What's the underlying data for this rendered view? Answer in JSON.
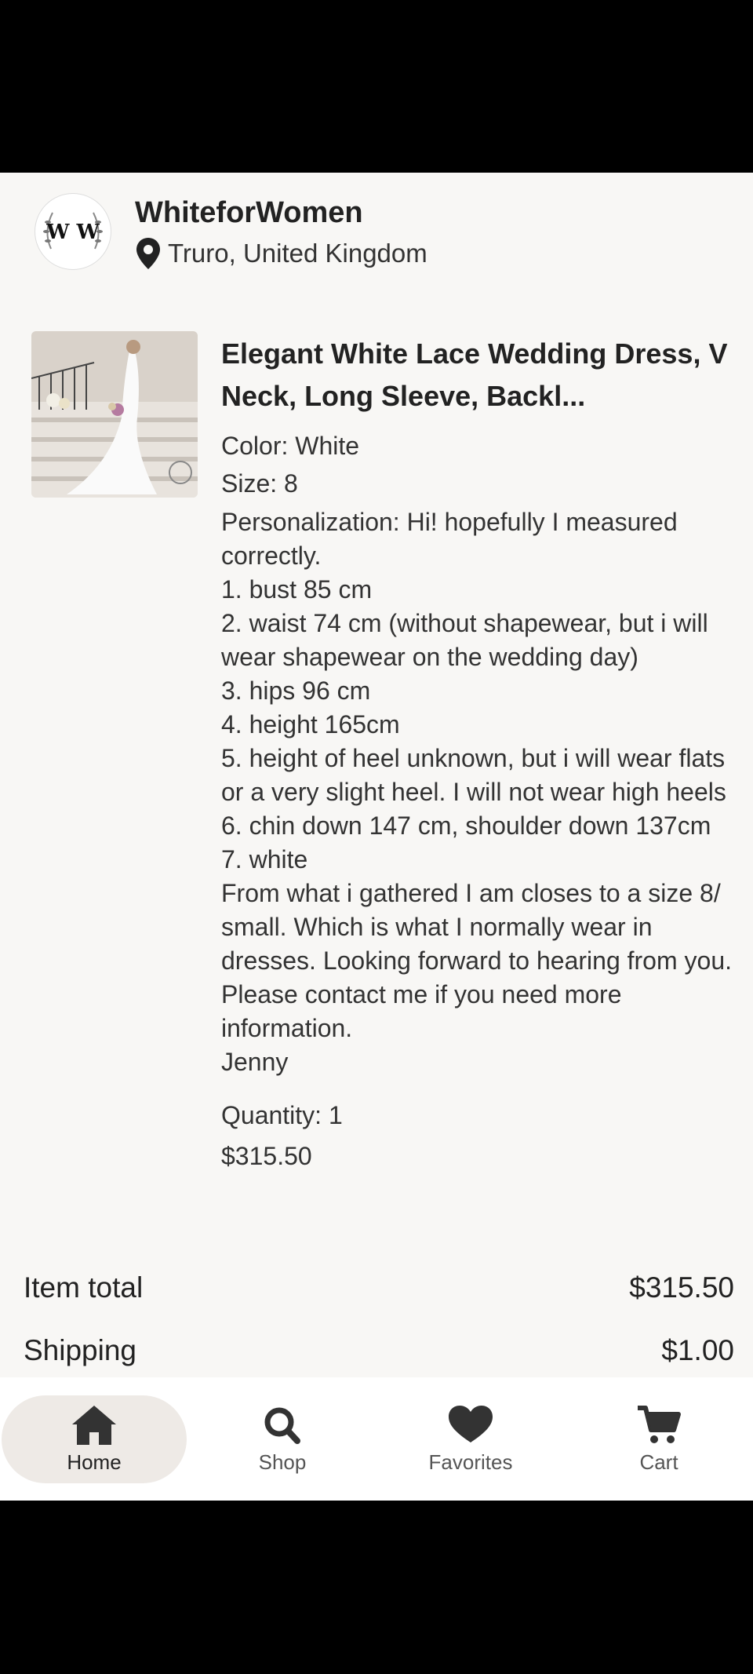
{
  "shop": {
    "logo_text": "W W",
    "name": "WhiteforWomen",
    "location": "Truro, United Kingdom"
  },
  "item": {
    "title": "Elegant White Lace Wedding Dress, V Neck, Long Sleeve, Backl...",
    "variants": [
      "Color: White",
      "Size: 8"
    ],
    "personalization_lines": [
      "Personalization: Hi! hopefully I measured correctly.",
      "1. bust 85 cm",
      "2. waist 74 cm (without shapewear, but i will wear shapewear on the wedding day)",
      "3. hips 96 cm",
      "4. height 165cm",
      "5. height of heel unknown, but i will wear flats or a very slight heel. I will not wear high heels",
      "6. chin down 147 cm, shoulder down 137cm",
      "7. white",
      "From what i gathered I am closes to a size 8/ small. Which is what I normally wear in dresses. Looking forward to hearing from you. Please contact me if you need more information.",
      "Jenny"
    ],
    "quantity": "Quantity: 1",
    "price": "$315.50"
  },
  "totals": {
    "item_total_label": "Item total",
    "item_total_value": "$315.50",
    "shipping_label": "Shipping",
    "shipping_value": "$1.00"
  },
  "nav": {
    "items": [
      {
        "label": "Home",
        "icon": "home-icon",
        "active": true
      },
      {
        "label": "Shop",
        "icon": "search-icon",
        "active": false
      },
      {
        "label": "Favorites",
        "icon": "heart-icon",
        "active": false
      },
      {
        "label": "Cart",
        "icon": "cart-icon",
        "active": false
      }
    ]
  },
  "colors": {
    "background": "#f8f7f5",
    "nav_active_bg": "#eeeae6",
    "icon": "#333333"
  }
}
